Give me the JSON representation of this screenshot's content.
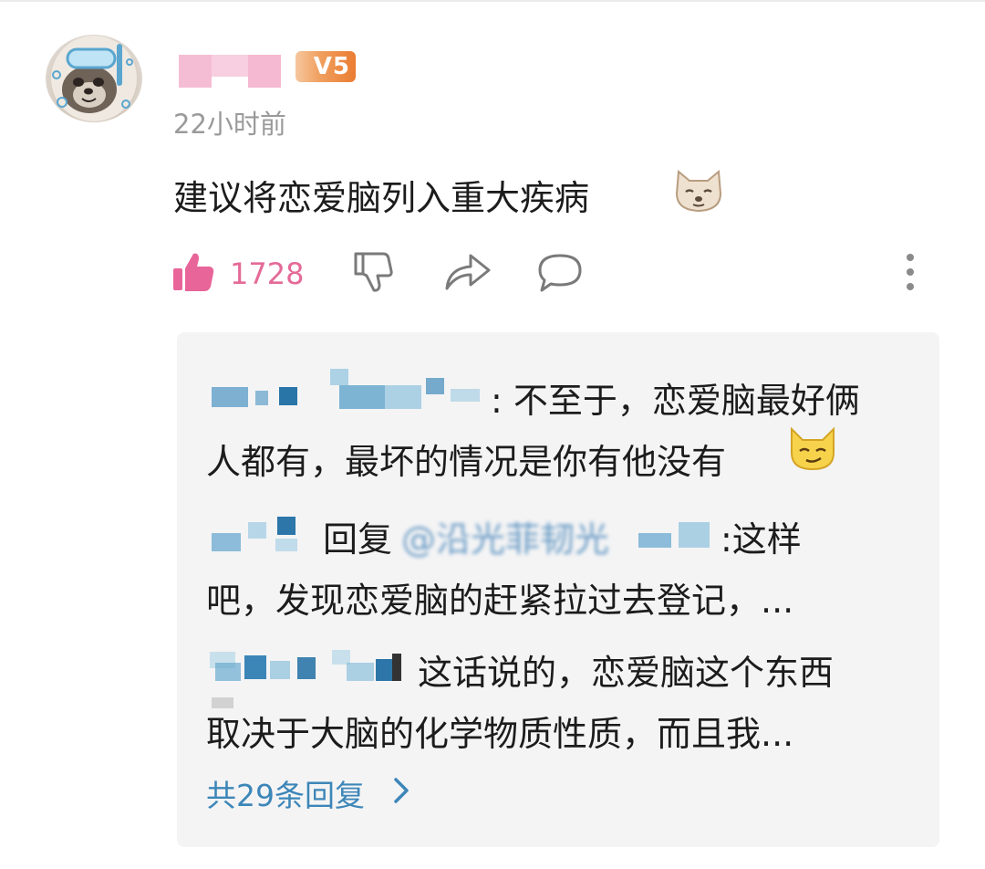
{
  "comment": {
    "timestamp": "22小时前",
    "vip_badge": "V5",
    "text": "建议将恋爱脑列入重大疾病",
    "emoji_icon": "dog-face-emoji",
    "like_count": "1728"
  },
  "replies": {
    "items": [
      {
        "text_line1": ": 不至于，恋爱脑最好俩",
        "text_line2": "人都有，最坏的情况是你有他没有",
        "emoji_icon": "smirking-cat-emoji"
      },
      {
        "reply_label": "回复",
        "mention": "@沿光菲韧光",
        "text_line1": ":这样",
        "text_line2": "吧，发现恋爱脑的赶紧拉过去登记，..."
      },
      {
        "text_line1": "这话说的，恋爱脑这个东西",
        "text_line2": "取决于大脑的化学物质性质，而且我..."
      }
    ],
    "total_label": "共29条回复"
  },
  "colors": {
    "like": "#e46a98",
    "link": "#3d86b8",
    "vip_badge": "#ea7d32",
    "panel_bg": "#f4f4f5"
  }
}
